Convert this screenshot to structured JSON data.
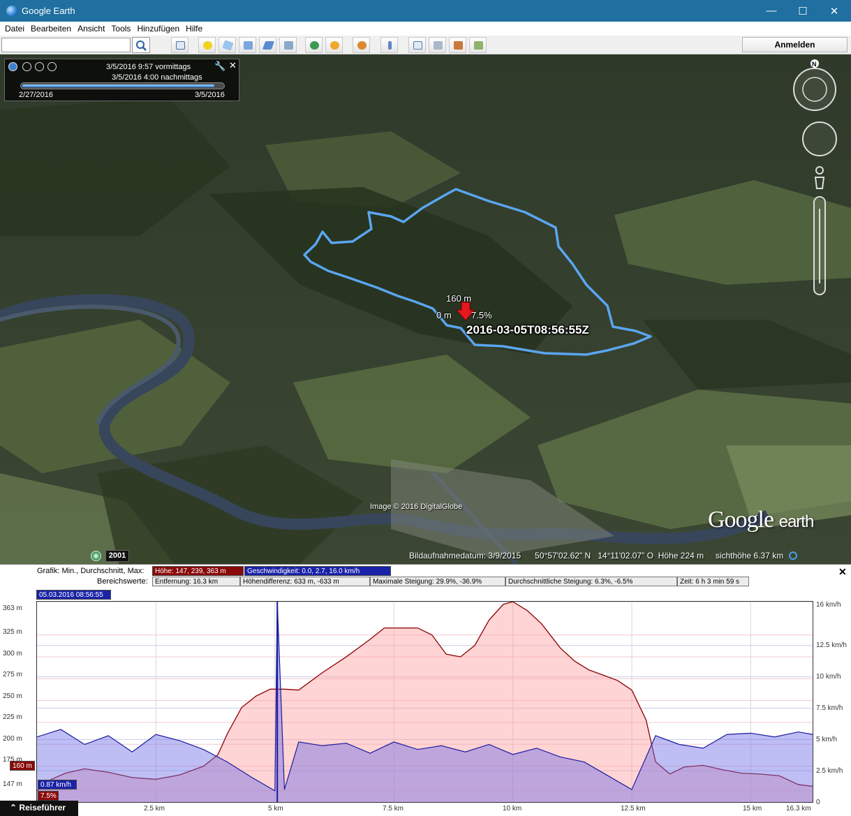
{
  "window": {
    "title": "Google Earth",
    "min": "—",
    "max": "☐",
    "close": "✕"
  },
  "menu": [
    "Datei",
    "Bearbeiten",
    "Ansicht",
    "Tools",
    "Hinzufügen",
    "Hilfe"
  ],
  "toolbar": {
    "search_value": "",
    "signin_label": "Anmelden"
  },
  "timeslider": {
    "start_time": "3/5/2016   9:57 vormittags",
    "end_time": "3/5/2016   4:00 nachmittags",
    "range_start": "2/27/2016",
    "range_end": "3/5/2016",
    "position": 0.95
  },
  "map": {
    "placemark": {
      "elev": "160 m",
      "distance": "0 m",
      "slope": "7.5%",
      "timestamp": "2016-03-05T08:56:55Z"
    },
    "image_credit": "Image © 2016 DigitalGlobe",
    "logo_main": "Google",
    "logo_sub": "earth",
    "history_year": "2001",
    "status": {
      "capture_date": "Bildaufnahmedatum: 3/9/2015",
      "lat": "50°57'02.62\" N",
      "lon": "14°11'02.07\" O",
      "elev": "Höhe   224 m",
      "eye_alt": "sichthöhe   6.37 km"
    }
  },
  "profile": {
    "graph_label": "Grafik: Min., Durchschnitt, Max:",
    "range_label": "Bereichswerte:",
    "height_chip": "Höhe: 147, 239, 363 m",
    "speed_chip": "Geschwindigkeit: 0.0, 2.7, 16.0 km/h",
    "distance": "Entfernung: 16.3 km",
    "height_diff": "Höhendifferenz: 633 m, -633 m",
    "max_slope": "Maximale Steigung: 29.9%, -36.9%",
    "avg_slope": "Durchschnittliche Steigung: 6.3%, -6.5%",
    "time": "Zeit: 6 h 3 min 59 s",
    "cursor_time": "05.03.2016 08:56:55",
    "cursor_height": "160 m",
    "cursor_speed": "0.87 km/h",
    "cursor_slope": "7.5%",
    "close": "✕",
    "guide_label": "Reiseführer"
  },
  "chart_data": {
    "type": "area",
    "xlabel": "",
    "xlim": [
      0,
      16.3
    ],
    "x_ticks": [
      "2.5 km",
      "5 km",
      "7.5 km",
      "10 km",
      "12.5 km",
      "15 km",
      "16.3 km"
    ],
    "y_left_ticks": [
      "363 m",
      "325 m",
      "300 m",
      "275 m",
      "250 m",
      "225 m",
      "200 m",
      "175 m",
      "147 m"
    ],
    "y_right_ticks": [
      "16 km/h",
      "12.5 km/h",
      "10 km/h",
      "7.5 km/h",
      "5 km/h",
      "2.5 km/h",
      "0"
    ],
    "ylim_left": [
      134,
      363
    ],
    "ylim_right": [
      0,
      16
    ],
    "cursor_x": 5.05,
    "series": [
      {
        "name": "Höhe",
        "unit": "m",
        "color": "#8b0000",
        "x": [
          0,
          0.3,
          0.6,
          1,
          1.5,
          2,
          2.5,
          3,
          3.5,
          3.8,
          4,
          4.3,
          4.6,
          4.9,
          5.2,
          5.5,
          6,
          6.5,
          7,
          7.3,
          7.6,
          8,
          8.3,
          8.6,
          8.9,
          9.2,
          9.5,
          9.8,
          10,
          10.3,
          10.6,
          11,
          11.3,
          11.6,
          11.9,
          12.2,
          12.5,
          12.8,
          13,
          13.3,
          13.6,
          14,
          14.4,
          14.8,
          15.2,
          15.6,
          16,
          16.3
        ],
        "values": [
          147,
          160,
          167,
          172,
          168,
          162,
          160,
          165,
          175,
          188,
          212,
          242,
          255,
          263,
          263,
          262,
          282,
          300,
          320,
          333,
          333,
          333,
          325,
          303,
          300,
          313,
          342,
          360,
          363,
          353,
          338,
          310,
          295,
          285,
          279,
          273,
          262,
          228,
          180,
          166,
          174,
          176,
          171,
          167,
          166,
          164,
          154,
          152
        ]
      },
      {
        "name": "Geschwindigkeit",
        "unit": "km/h",
        "color": "#1a1aa0",
        "x": [
          0,
          0.5,
          1,
          1.5,
          2,
          2.5,
          3,
          3.5,
          4,
          4.5,
          5,
          5.05,
          5.2,
          5.5,
          6,
          6.5,
          7,
          7.5,
          8,
          8.5,
          9,
          9.5,
          10,
          10.5,
          11,
          11.5,
          12,
          12.5,
          13,
          13.5,
          14,
          14.5,
          15,
          15.5,
          16,
          16.3
        ],
        "values": [
          5.2,
          5.8,
          4.6,
          5.3,
          4.0,
          5.4,
          4.9,
          4.2,
          3.2,
          2.0,
          0.9,
          16.0,
          1.0,
          4.8,
          4.5,
          4.7,
          3.9,
          4.8,
          4.2,
          4.5,
          4.0,
          4.6,
          3.8,
          4.3,
          3.6,
          3.2,
          2.1,
          1.0,
          5.3,
          4.6,
          4.3,
          5.4,
          5.5,
          5.2,
          5.6,
          5.4
        ]
      }
    ]
  }
}
